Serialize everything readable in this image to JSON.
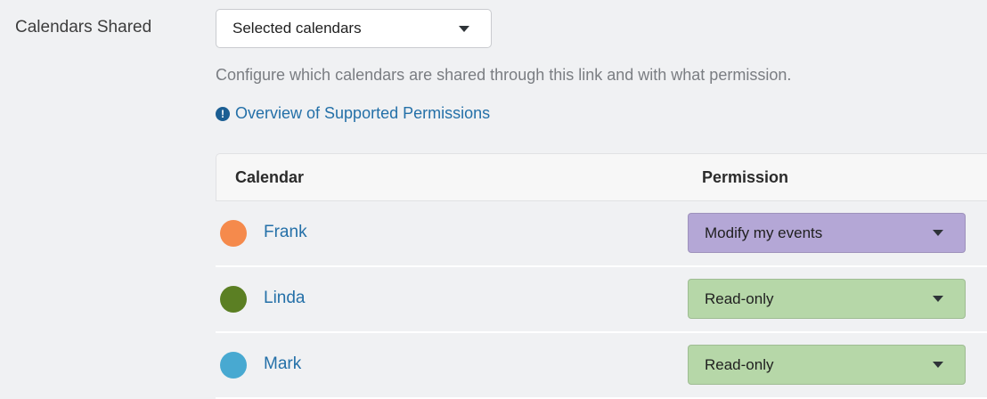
{
  "field": {
    "label": "Calendars Shared",
    "select_value": "Selected calendars",
    "help_text": "Configure which calendars are shared through this link and with what permission.",
    "overview_link": "Overview of Supported Permissions"
  },
  "table": {
    "headers": {
      "calendar": "Calendar",
      "permission": "Permission"
    },
    "rows": [
      {
        "name": "Frank",
        "color": "#f58a4c",
        "permission": "Modify my events",
        "permission_color": "#b4a7d6"
      },
      {
        "name": "Linda",
        "color": "#5b7f23",
        "permission": "Read-only",
        "permission_color": "#b6d7a8"
      },
      {
        "name": "Mark",
        "color": "#48a9d1",
        "permission": "Read-only",
        "permission_color": "#b6d7a8"
      }
    ]
  }
}
